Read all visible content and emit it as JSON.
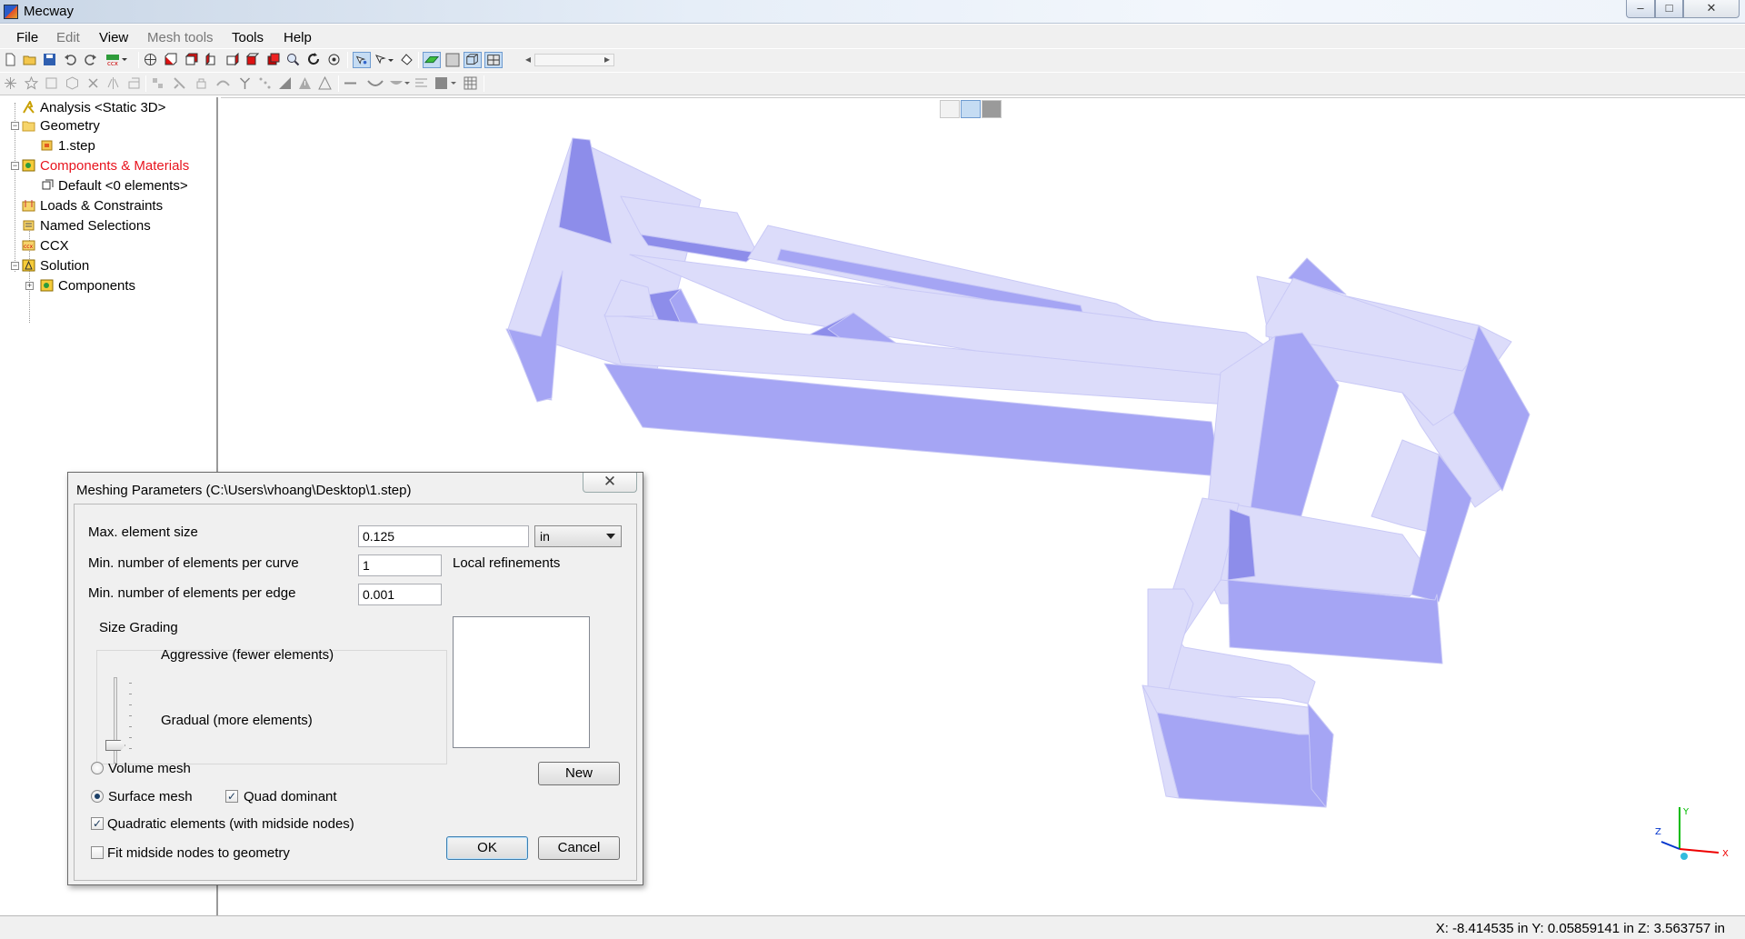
{
  "window": {
    "title": "Mecway",
    "controls": {
      "minimize": "–",
      "maximize": "□",
      "close": "✕"
    }
  },
  "menu": {
    "items": [
      {
        "label": "File",
        "enabled": true
      },
      {
        "label": "Edit",
        "enabled": false
      },
      {
        "label": "View",
        "enabled": true
      },
      {
        "label": "Mesh tools",
        "enabled": false
      },
      {
        "label": "Tools",
        "enabled": true
      },
      {
        "label": "Help",
        "enabled": true
      }
    ]
  },
  "toolbar": {
    "scroll_left": "◂",
    "scroll_right": "▸",
    "toolbar1_icons": [
      "new-file-icon",
      "open-folder-icon",
      "save-icon",
      "undo-icon",
      "redo-icon",
      "ccx-run-icon",
      "wireframe-cube-icon",
      "view-front-icon",
      "view-back-icon",
      "view-left-icon",
      "view-right-icon",
      "view-top-icon",
      "view-bottom-icon",
      "zoom-icon",
      "rotate-icon",
      "pan-icon",
      "select-nodes-icon",
      "select-elements-icon",
      "select-faces-icon",
      "surface-shaded-icon",
      "shaded-icon",
      "hidden-lines-icon",
      "mesh-edges-icon"
    ],
    "toolbar2_icons": [
      "explode-icon",
      "star-icon",
      "box-icon",
      "cube-outline-icon",
      "delete-icon",
      "mirror-icon",
      "extrude-icon",
      "split-icon",
      "merge-icon",
      "lock-icon",
      "refine-icon",
      "branch-icon",
      "node-scatter-icon",
      "measure-icon",
      "warning-icon",
      "triangle-icon",
      "line-icon",
      "arc-icon",
      "bowl-icon",
      "align-icon",
      "grid-icon",
      "table-icon"
    ]
  },
  "tree": {
    "items": [
      {
        "label": "Analysis <Static 3D>",
        "icon": "analysis-icon",
        "indent": 0,
        "color": "#000000"
      },
      {
        "label": "Geometry",
        "icon": "folder-icon",
        "indent": 0,
        "expander": "−",
        "color": "#000000"
      },
      {
        "label": "1.step",
        "icon": "step-file-icon",
        "indent": 1,
        "color": "#000000"
      },
      {
        "label": "Components & Materials",
        "icon": "components-icon",
        "indent": 0,
        "expander": "−",
        "color": "#e8141e"
      },
      {
        "label": "Default <0 elements>",
        "icon": "material-icon",
        "indent": 1,
        "color": "#000000"
      },
      {
        "label": "Loads & Constraints",
        "icon": "loads-icon",
        "indent": 0,
        "color": "#000000"
      },
      {
        "label": "Named Selections",
        "icon": "named-selection-icon",
        "indent": 0,
        "color": "#000000"
      },
      {
        "label": "CCX",
        "icon": "ccx-icon",
        "indent": 0,
        "color": "#000000"
      },
      {
        "label": "Solution",
        "icon": "solution-icon",
        "indent": 0,
        "expander": "−",
        "color": "#000000"
      },
      {
        "label": "Components",
        "icon": "components-icon",
        "indent": 1,
        "expander": "+",
        "color": "#000000"
      }
    ]
  },
  "viewport": {
    "model_colors": {
      "top": "#dcdcfa",
      "side": "#a5a5f4",
      "dark": "#8d8dea",
      "edge": "#c9c9f6"
    },
    "view_modes": [
      "wireframe-view-icon",
      "shaded-edges-view-icon",
      "shaded-view-icon"
    ]
  },
  "axes": {
    "x": "X",
    "y": "Y",
    "z": "Z"
  },
  "status": {
    "coords": "X: -8.414535 in Y: 0.05859141 in Z: 3.563757 in"
  },
  "dialog": {
    "title": "Meshing Parameters (C:\\Users\\vhoang\\Desktop\\1.step)",
    "close_glyph": "✕",
    "max_element_size_label": "Max. element size",
    "max_element_size_value": "0.125",
    "unit": "in",
    "min_per_curve_label": "Min. number of elements per curve",
    "min_per_curve_value": "1",
    "min_per_edge_label": "Min. number of elements per edge",
    "min_per_edge_value": "0.001",
    "local_refinements_label": "Local refinements",
    "size_grading_label": "Size Grading",
    "aggressive_label": "Aggressive (fewer elements)",
    "gradual_label": "Gradual (more elements)",
    "volume_mesh_label": "Volume mesh",
    "surface_mesh_label": "Surface mesh",
    "quad_dominant_label": "Quad dominant",
    "quadratic_label": "Quadratic elements (with midside nodes)",
    "fit_midside_label": "Fit midside nodes to geometry",
    "new_button": "New",
    "ok_button": "OK",
    "cancel_button": "Cancel",
    "check_glyph": "✓",
    "state": {
      "volume_mesh": false,
      "surface_mesh": true,
      "quad_dominant": true,
      "quadratic": true,
      "fit_midside": false,
      "grading_level": 1.0
    }
  }
}
